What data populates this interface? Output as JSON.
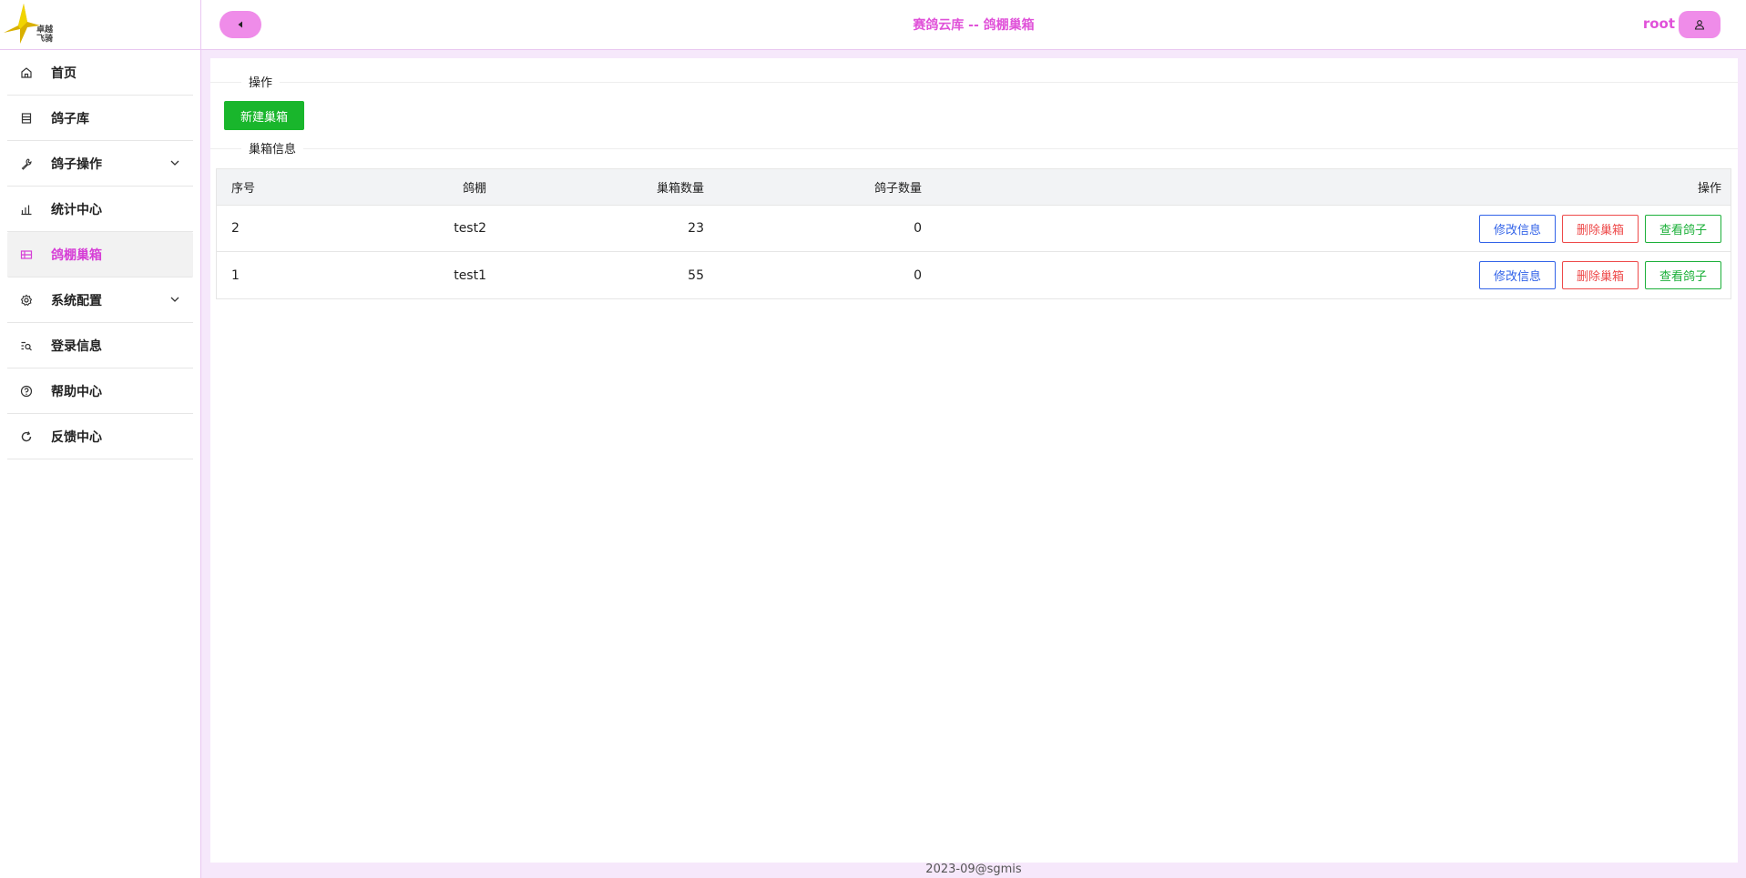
{
  "logo": {
    "text": "卓越飞骑"
  },
  "sidebar": {
    "items": [
      {
        "label": "首页",
        "icon": "home-icon"
      },
      {
        "label": "鸽子库",
        "icon": "list-icon"
      },
      {
        "label": "鸽子操作",
        "icon": "wrench-icon",
        "expandable": true
      },
      {
        "label": "统计中心",
        "icon": "bar-chart-icon"
      },
      {
        "label": "鸽棚巢箱",
        "icon": "grid-icon",
        "active": true
      },
      {
        "label": "系统配置",
        "icon": "gear-icon",
        "expandable": true
      },
      {
        "label": "登录信息",
        "icon": "search-list-icon"
      },
      {
        "label": "帮助中心",
        "icon": "help-circle-icon"
      },
      {
        "label": "反馈中心",
        "icon": "refresh-icon"
      }
    ]
  },
  "header": {
    "title": "赛鸽云库 -- 鸽棚巢箱",
    "user": "root"
  },
  "main": {
    "operations_label": "操作",
    "new_button": "新建巢箱",
    "info_label": "巢箱信息",
    "table": {
      "columns": [
        "序号",
        "鸽棚",
        "巢箱数量",
        "鸽子数量",
        "操作"
      ],
      "rows": [
        {
          "idx": "2",
          "loft": "test2",
          "boxes": "23",
          "pigeons": "0"
        },
        {
          "idx": "1",
          "loft": "test1",
          "boxes": "55",
          "pigeons": "0"
        }
      ],
      "actions": {
        "edit": "修改信息",
        "delete": "删除巢箱",
        "view": "查看鸽子"
      }
    }
  },
  "footer": {
    "text": "2023-09@sgmis"
  },
  "colors": {
    "accent": "#e052d9",
    "accent_bg": "#ef8ce9",
    "green": "#19b62c",
    "blue": "#3263e8",
    "red": "#ee4a4a"
  }
}
